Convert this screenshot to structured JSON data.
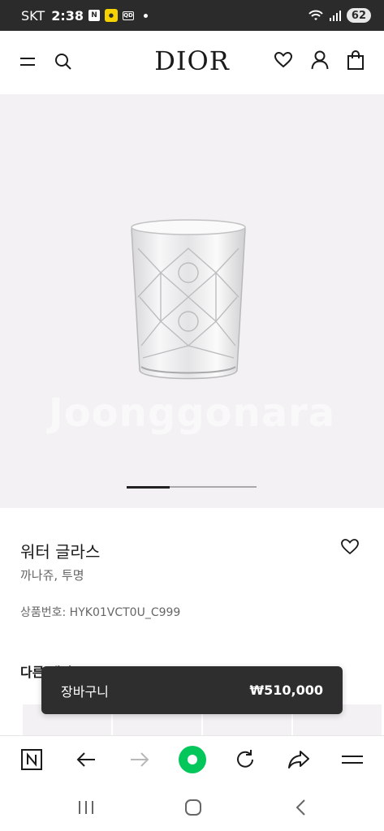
{
  "status_bar": {
    "carrier": "SKT",
    "time": "2:38",
    "notif_n": "N",
    "notif_kakao": "Kakao",
    "notif_msg": "QD",
    "battery": "62"
  },
  "header": {
    "logo": "DIOR",
    "icons": [
      "menu-icon",
      "search-icon",
      "heart-icon",
      "account-icon",
      "bag-icon"
    ]
  },
  "gallery": {
    "watermark": "Joonggonara",
    "progress": 0.33
  },
  "product": {
    "title": "워터 글라스",
    "variant": "까나쥬, 투명",
    "sku": "상품번호: HYK01VCT0U_C999",
    "other_options_label": "다른 색상"
  },
  "cart": {
    "label": "장바구니",
    "price": "₩510,000"
  },
  "browser_toolbar": {
    "icons": [
      "naver-n-icon",
      "back-arrow-icon",
      "forward-arrow-icon",
      "naver-green-dot-icon",
      "refresh-icon",
      "share-icon",
      "menu-icon"
    ],
    "n_label": "N"
  },
  "system_nav": {
    "icons": [
      "recent-apps-icon",
      "home-icon",
      "back-icon"
    ]
  },
  "colors": {
    "status_bg": "#2b2b2b",
    "image_bg": "#f3f1f3",
    "cart_bg": "#2e2e2e",
    "naver_green": "#03c75a"
  }
}
